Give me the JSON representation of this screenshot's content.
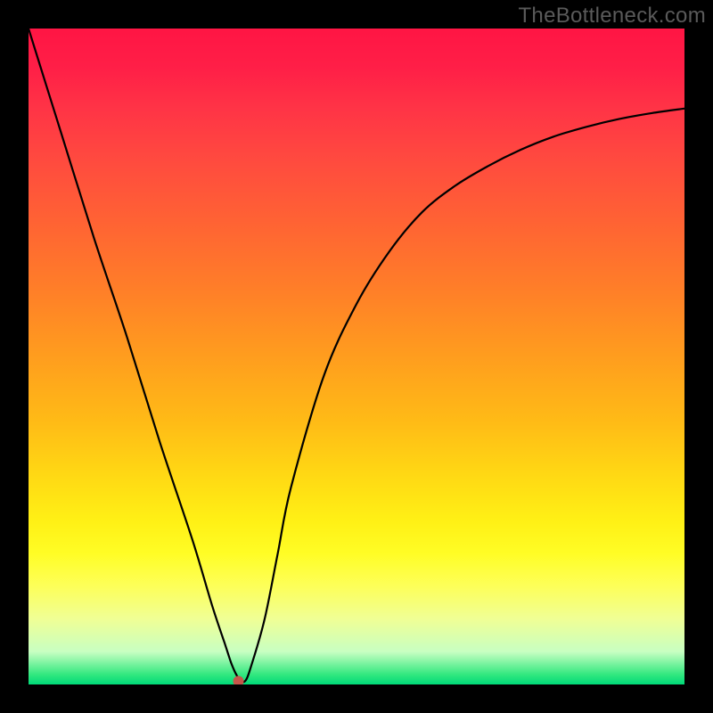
{
  "watermark_text": "TheBottleneck.com",
  "chart_data": {
    "type": "line",
    "title": "",
    "xlabel": "",
    "ylabel": "",
    "xlim": [
      0,
      100
    ],
    "ylim": [
      0,
      100
    ],
    "series": [
      {
        "name": "bottleneck-curve",
        "x": [
          0,
          5,
          10,
          15,
          20,
          25,
          28,
          30,
          31,
          32,
          33,
          34,
          36,
          38,
          40,
          45,
          50,
          55,
          60,
          65,
          70,
          75,
          80,
          85,
          90,
          95,
          100
        ],
        "values": [
          100,
          84,
          68,
          53,
          37,
          22,
          12,
          6,
          3,
          1,
          0.5,
          3,
          10,
          20,
          30,
          47,
          58,
          66,
          72,
          76,
          79,
          81.5,
          83.5,
          85,
          86.2,
          87.1,
          87.8
        ]
      }
    ],
    "marker": {
      "x": 32,
      "y": 0.5,
      "color": "#c5564a"
    },
    "gradient_stops": [
      {
        "pos": 0.0,
        "color": "#ff1544"
      },
      {
        "pos": 0.5,
        "color": "#ff9d1e"
      },
      {
        "pos": 0.8,
        "color": "#fffd25"
      },
      {
        "pos": 1.0,
        "color": "#00d978"
      }
    ]
  }
}
